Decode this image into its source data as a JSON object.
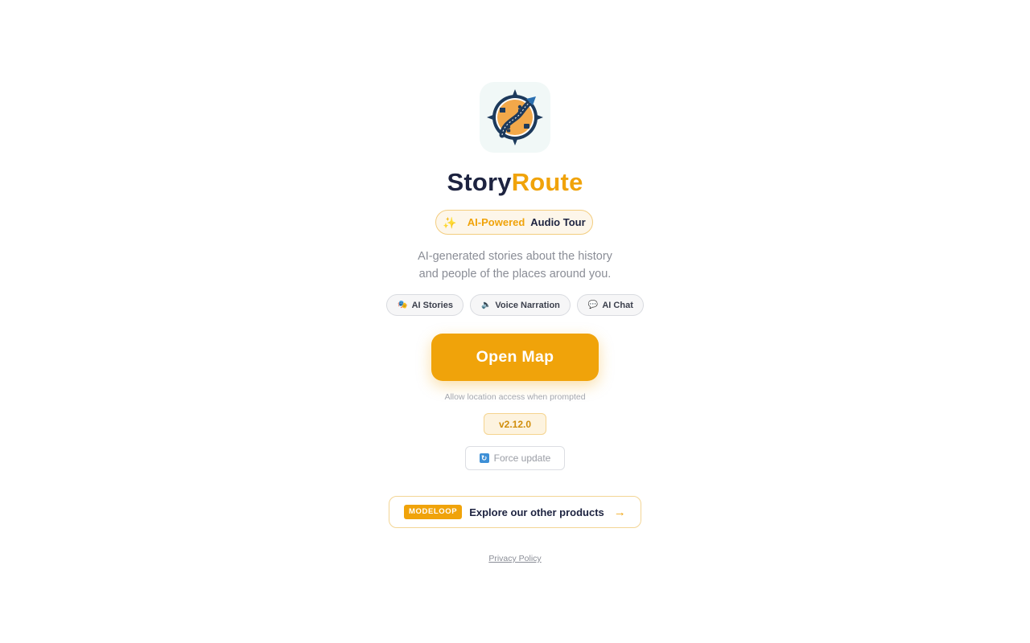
{
  "app": {
    "title_part1": "Story",
    "title_part2": "Route"
  },
  "badge": {
    "icon": "sparkles-icon",
    "highlight": "AI-Powered",
    "text": "Audio Tour"
  },
  "description": {
    "line1": "AI-generated stories about the history",
    "line2": "and people of the places around you."
  },
  "features": [
    {
      "icon": "theater-masks-icon",
      "label": "AI Stories"
    },
    {
      "icon": "speaker-icon",
      "label": "Voice Narration"
    },
    {
      "icon": "speech-bubble-icon",
      "label": "AI Chat"
    }
  ],
  "primary_action": {
    "label": "Open Map"
  },
  "hint": "Allow location access when prompted",
  "version": "v2.12.0",
  "force_update": {
    "icon": "refresh-icon",
    "label": "Force update"
  },
  "products": {
    "brand": "MODELOOP",
    "label": "Explore our other products",
    "arrow": "→"
  },
  "footer": {
    "privacy": "Privacy Policy"
  },
  "colors": {
    "accent": "#f0a30a",
    "navy": "#1d2340"
  }
}
